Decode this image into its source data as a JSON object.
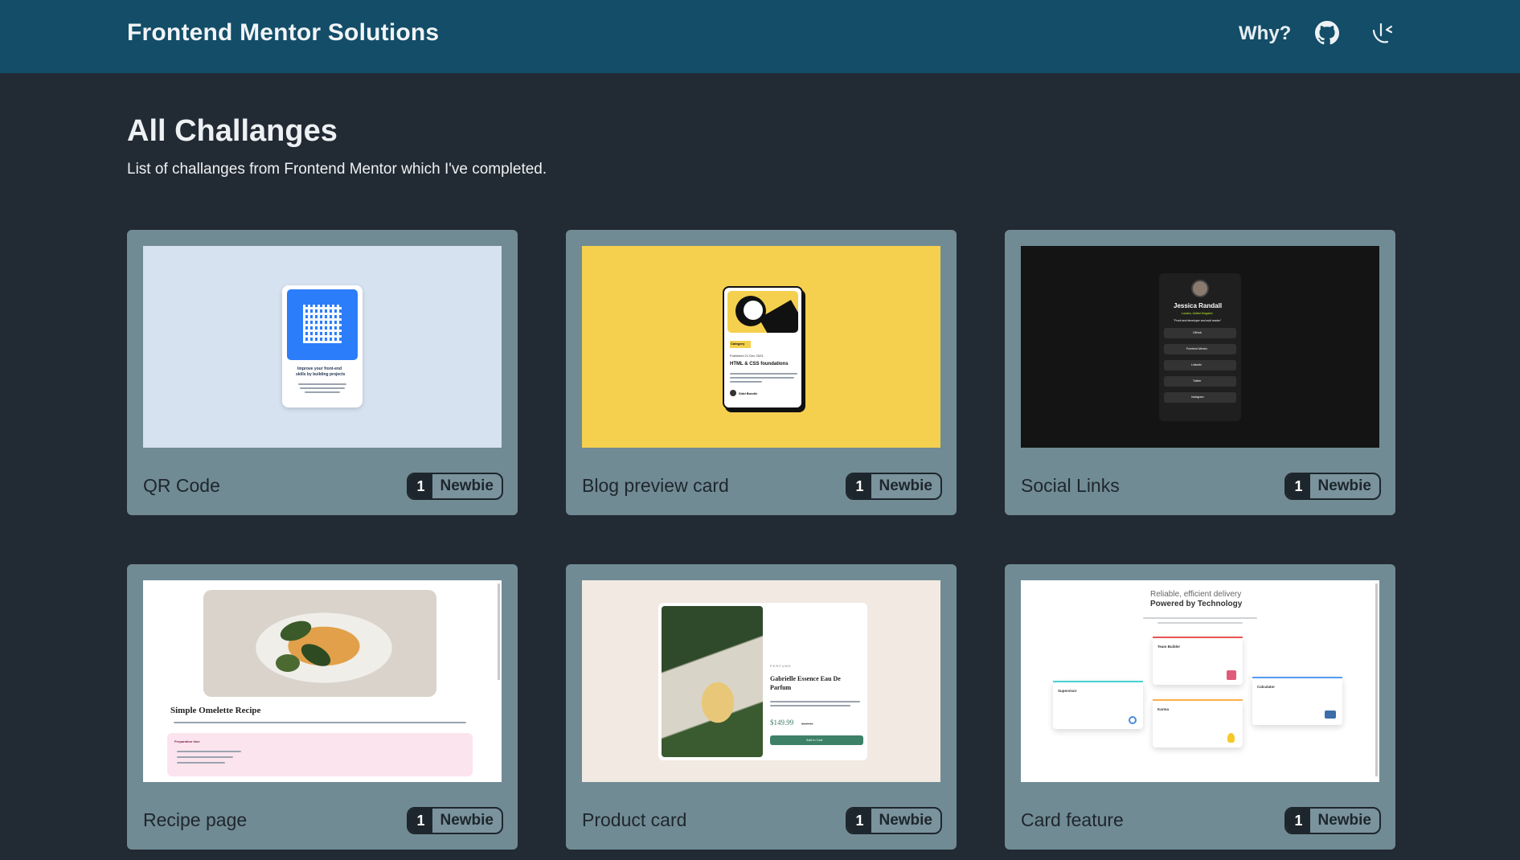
{
  "header": {
    "brand": "Frontend Mentor Solutions",
    "nav_why": "Why?",
    "github_icon": "github-icon",
    "profile_icon": "profile-logo-icon"
  },
  "main": {
    "title": "All Challanges",
    "subtitle": "List of challanges from Frontend Mentor which I've completed."
  },
  "challenges": [
    {
      "title": "QR Code",
      "count": "1",
      "level": "Newbie"
    },
    {
      "title": "Blog preview card",
      "count": "1",
      "level": "Newbie"
    },
    {
      "title": "Social Links",
      "count": "1",
      "level": "Newbie"
    },
    {
      "title": "Recipe page",
      "count": "1",
      "level": "Newbie"
    },
    {
      "title": "Product card",
      "count": "1",
      "level": "Newbie"
    },
    {
      "title": "Card feature",
      "count": "1",
      "level": "Newbie"
    }
  ],
  "thumbs": {
    "qr": {
      "line1": "Improve your front-end",
      "line2": "skills by building projects"
    },
    "blog": {
      "tag": "Category",
      "published": "Published 21 Dec 2023",
      "heading": "HTML & CSS foundations",
      "author": "Sidd Bundle"
    },
    "social": {
      "name": "Jessica Randall",
      "location": "London, United Kingdom",
      "quote": "\"Front-end developer and avid reader\"",
      "links": [
        "GitHub",
        "Frontend Mentor",
        "LinkedIn",
        "Twitter",
        "Instagram"
      ]
    },
    "recipe": {
      "title": "Simple Omelette Recipe",
      "prep": "Preparation time"
    },
    "product": {
      "category": "PERFUME",
      "name1": "Gabrielle Essence Eau De",
      "name2": "Parfum",
      "price": "$149.99",
      "old_price": "$169.99",
      "cta": "Add to Cart"
    },
    "feature": {
      "line1": "Reliable, efficient delivery",
      "line2": "Powered by Technology",
      "c1": "Supervisor",
      "c2": "Team Builder",
      "c3": "Karma",
      "c4": "Calculator"
    }
  },
  "colors": {
    "header_bg": "#134d68",
    "page_bg": "#222a33",
    "card_bg": "#718b94",
    "badge_dark": "#1e262d"
  }
}
